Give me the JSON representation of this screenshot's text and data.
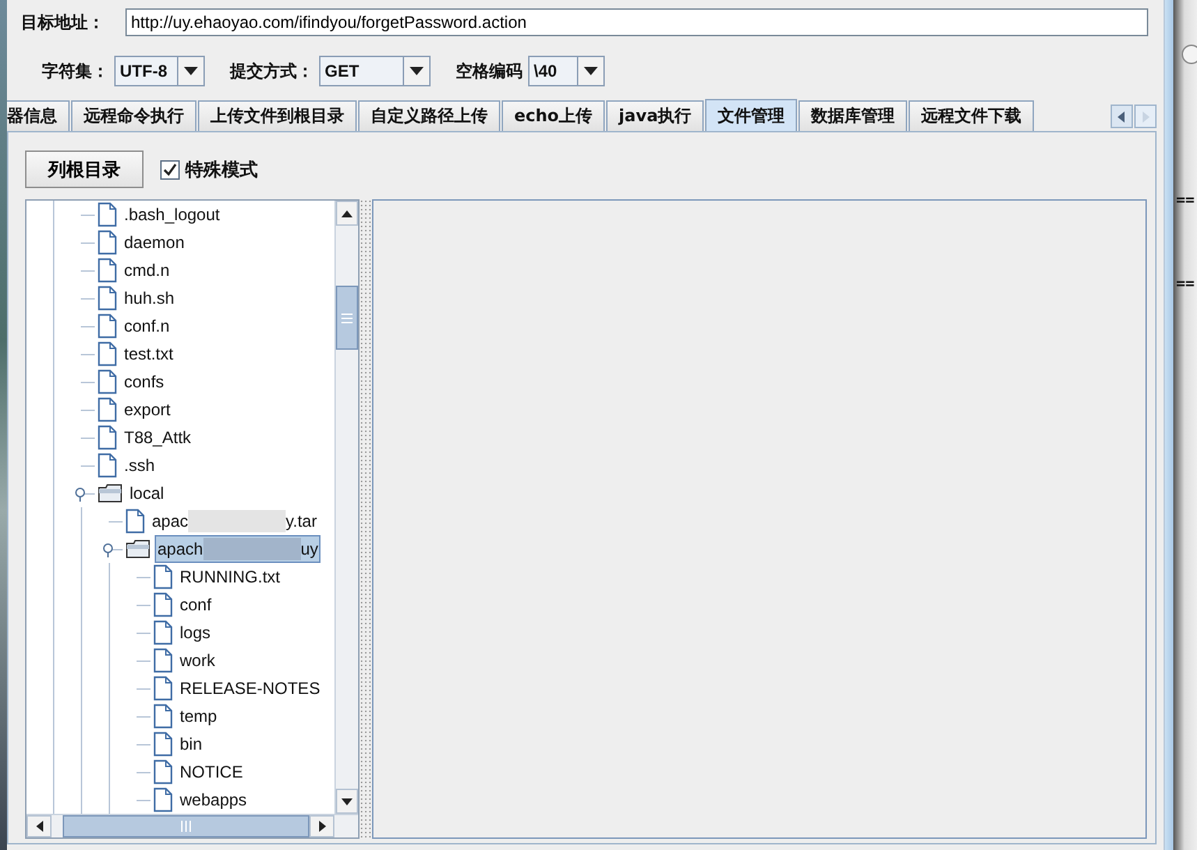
{
  "target": {
    "label": "目标地址：",
    "value": "http://uy.ehaoyao.com/ifindyou/forgetPassword.action"
  },
  "options": [
    {
      "label": "字符集：",
      "value": "UTF-8"
    },
    {
      "label": "提交方式：",
      "value": "GET"
    },
    {
      "label": "空格编码",
      "value": "\\40"
    }
  ],
  "tabs": [
    {
      "label": "器信息",
      "selected": false
    },
    {
      "label": "远程命令执行",
      "selected": false
    },
    {
      "label": "上传文件到根目录",
      "selected": false
    },
    {
      "label": "自定义路径上传",
      "selected": false
    },
    {
      "label": "echo上传",
      "selected": false
    },
    {
      "label": "java执行",
      "selected": false
    },
    {
      "label": "文件管理",
      "selected": true
    },
    {
      "label": "数据库管理",
      "selected": false
    },
    {
      "label": "远程文件下载",
      "selected": false
    }
  ],
  "list_root_button": "列根目录",
  "special_mode": {
    "label": "特殊模式",
    "checked": true
  },
  "tree": [
    {
      "kind": "file",
      "label": ".bash_logout",
      "selected": false
    },
    {
      "kind": "file",
      "label": "daemon",
      "selected": false
    },
    {
      "kind": "file",
      "label": "cmd.n",
      "selected": false
    },
    {
      "kind": "file",
      "label": "huh.sh",
      "selected": false
    },
    {
      "kind": "file",
      "label": "conf.n",
      "selected": false
    },
    {
      "kind": "file",
      "label": "test.txt",
      "selected": false
    },
    {
      "kind": "file",
      "label": "confs",
      "selected": false
    },
    {
      "kind": "file",
      "label": "export",
      "selected": false
    },
    {
      "kind": "file",
      "label": "T88_Attk",
      "selected": false
    },
    {
      "kind": "file",
      "label": ".ssh",
      "selected": false
    },
    {
      "kind": "folder",
      "label": "local",
      "selected": false,
      "expanded": true,
      "children": [
        {
          "kind": "file",
          "label": "apac",
          "label_end": "y.tar",
          "selected": false
        },
        {
          "kind": "folder",
          "label": "apach",
          "label_end": "uy",
          "selected": true,
          "expanded": true,
          "children": [
            {
              "kind": "file",
              "label": "RUNNING.txt",
              "selected": false
            },
            {
              "kind": "file",
              "label": "conf",
              "selected": false
            },
            {
              "kind": "file",
              "label": "logs",
              "selected": false
            },
            {
              "kind": "file",
              "label": "work",
              "selected": false
            },
            {
              "kind": "file",
              "label": "RELEASE-NOTES",
              "selected": false
            },
            {
              "kind": "file",
              "label": "temp",
              "selected": false
            },
            {
              "kind": "file",
              "label": "bin",
              "selected": false
            },
            {
              "kind": "file",
              "label": "NOTICE",
              "selected": false
            },
            {
              "kind": "file",
              "label": "webapps",
              "selected": false
            }
          ]
        }
      ]
    }
  ],
  "background_window": {
    "marks": [
      "==",
      "=="
    ]
  }
}
